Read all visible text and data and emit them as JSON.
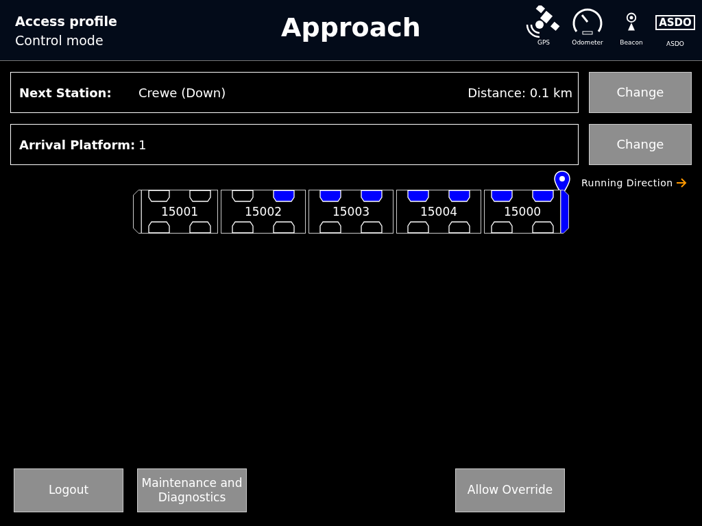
{
  "header": {
    "profile": "Access profile",
    "mode": "Control mode",
    "title": "Approach",
    "status_icons": [
      {
        "kind": "gps",
        "label": "GPS"
      },
      {
        "kind": "odometer",
        "label": "Odometer"
      },
      {
        "kind": "beacon",
        "label": "Beacon"
      },
      {
        "kind": "asdo",
        "label": "ASDO",
        "text": "ASDO"
      }
    ]
  },
  "next_station": {
    "label": "Next Station:",
    "value": "Crewe (Down)",
    "distance": "Distance: 0.1 km",
    "button": "Change"
  },
  "arrival_platform": {
    "label": "Arrival Platform:",
    "value": "1",
    "button": "Change"
  },
  "running_direction": "Running Direction",
  "cars": [
    {
      "number": "15001",
      "kind": "leading",
      "cab_active": false,
      "doors_top": [
        false,
        false
      ],
      "doors_bottom": [
        false,
        false
      ]
    },
    {
      "number": "15002",
      "kind": "middle",
      "doors_top": [
        false,
        true
      ],
      "doors_bottom": [
        false,
        false
      ]
    },
    {
      "number": "15003",
      "kind": "middle",
      "doors_top": [
        true,
        true
      ],
      "doors_bottom": [
        false,
        false
      ]
    },
    {
      "number": "15004",
      "kind": "middle",
      "doors_top": [
        true,
        true
      ],
      "doors_bottom": [
        false,
        false
      ]
    },
    {
      "number": "15000",
      "kind": "trailing",
      "cab_active": true,
      "doors_top": [
        true,
        true
      ],
      "doors_bottom": [
        false,
        false
      ]
    }
  ],
  "footer_left_buttons": [
    "Logout",
    "Maintenance and Diagnostics"
  ],
  "footer_right_buttons": [
    "Allow Override"
  ]
}
